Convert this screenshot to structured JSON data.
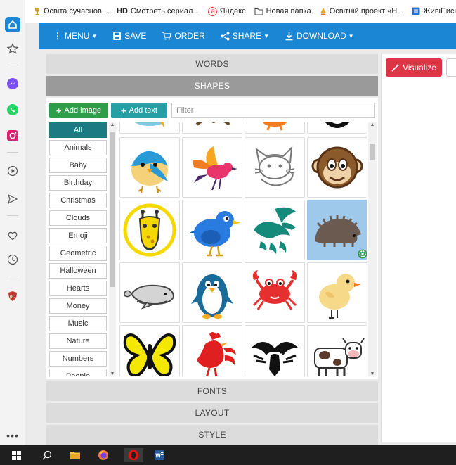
{
  "bookmarks": [
    {
      "label": "Освіта сучаснов...",
      "icon": "trophy-icon",
      "prefix": ""
    },
    {
      "label": "Смотреть сериал...",
      "icon": "hd-icon",
      "prefix": "HD"
    },
    {
      "label": "Яндекс",
      "icon": "yandex-icon",
      "prefix": ""
    },
    {
      "label": "Новая папка",
      "icon": "folder-icon",
      "prefix": ""
    },
    {
      "label": "Освітній проект «Н...",
      "icon": "bulb-icon",
      "prefix": ""
    },
    {
      "label": "ЖивіПисьме",
      "icon": "doc-icon",
      "prefix": ""
    }
  ],
  "nav": {
    "menu": "MENU",
    "save": "SAVE",
    "order": "ORDER",
    "share": "SHARE",
    "download": "DOWNLOAD"
  },
  "sections": {
    "words": "WORDS",
    "shapes": "SHAPES",
    "fonts": "FONTS",
    "layout": "LAYOUT",
    "style": "STYLE"
  },
  "toolbar": {
    "add_image": "Add image",
    "add_text": "Add text",
    "filter_placeholder": "Filter"
  },
  "categories": [
    "All",
    "Animals",
    "Baby",
    "Birthday",
    "Christmas",
    "Clouds",
    "Emoji",
    "Geometric",
    "Halloween",
    "Hearts",
    "Money",
    "Music",
    "Nature",
    "Numbers",
    "People"
  ],
  "selected_category": "All",
  "shapes": [
    "bird-icon",
    "flying-bird-icon",
    "cat-icon",
    "monkey-icon",
    "giraffe-icon",
    "blue-bird-icon",
    "dove-icon",
    "hedgehog-icon",
    "whale-icon",
    "penguin-icon",
    "crab-icon",
    "chick-icon",
    "butterfly-icon",
    "rooster-icon",
    "eagle-icon",
    "cow-icon"
  ],
  "selected_shape": "hedgehog-icon",
  "visualize_label": "Visualize",
  "colors": {
    "nav": "#1b86d3",
    "add_image": "#2e9e4a",
    "add_text": "#26a0a4",
    "category_active": "#1c7a83",
    "visualize": "#dc3545",
    "selected_shape": "#9ec9ea"
  }
}
